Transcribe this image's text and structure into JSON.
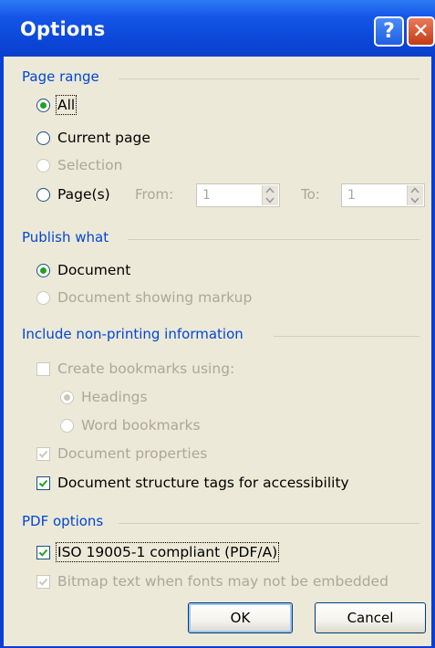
{
  "window": {
    "title": "Options",
    "help_glyph": "?",
    "close_glyph": "✕"
  },
  "groups": {
    "page_range": {
      "title": "Page range",
      "options": [
        {
          "label": "All",
          "selected": true,
          "enabled": true
        },
        {
          "label": "Current page",
          "selected": false,
          "enabled": true
        },
        {
          "label": "Selection",
          "selected": false,
          "enabled": false
        },
        {
          "label": "Page(s)",
          "selected": false,
          "enabled": true
        }
      ],
      "from_label": "From:",
      "from_value": "1",
      "to_label": "To:",
      "to_value": "1"
    },
    "publish_what": {
      "title": "Publish what",
      "options": [
        {
          "label": "Document",
          "selected": true,
          "enabled": true
        },
        {
          "label": "Document showing markup",
          "selected": false,
          "enabled": false
        }
      ]
    },
    "nonprinting": {
      "title": "Include non-printing information",
      "create_bookmarks": {
        "label": "Create bookmarks using:",
        "checked": false,
        "enabled": false
      },
      "bookmark_options": [
        {
          "label": "Headings",
          "selected": true,
          "enabled": false
        },
        {
          "label": "Word bookmarks",
          "selected": false,
          "enabled": false
        }
      ],
      "doc_properties": {
        "label": "Document properties",
        "checked": true,
        "enabled": false
      },
      "structure_tags": {
        "label": "Document structure tags for accessibility",
        "checked": true,
        "enabled": true
      }
    },
    "pdf_options": {
      "title": "PDF options",
      "iso": {
        "label": "ISO 19005-1 compliant (PDF/A)",
        "checked": true,
        "enabled": true
      },
      "bitmap": {
        "label": "Bitmap text when fonts may not be embedded",
        "checked": true,
        "enabled": false
      }
    }
  },
  "buttons": {
    "ok": "OK",
    "cancel": "Cancel"
  },
  "colors": {
    "title_bar": "#0c47d9",
    "group_title": "#0046d5",
    "disabled_text": "#aca899",
    "radio_dot": "#21a121",
    "check_mark": "#21a121"
  }
}
